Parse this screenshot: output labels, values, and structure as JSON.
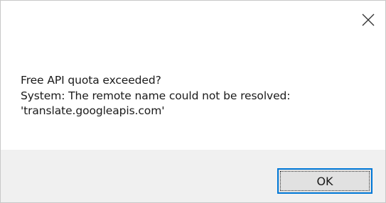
{
  "dialog": {
    "close_icon": "close-icon",
    "message_lines": [
      "Free API quota exceeded?",
      "System: The remote name could not be resolved:",
      "'translate.googleapis.com'"
    ],
    "ok_label": "OK"
  },
  "colors": {
    "accent": "#0078d7",
    "footer_bg": "#f0f0f0",
    "button_bg": "#e1e1e1",
    "text": "#1a1a1a"
  }
}
